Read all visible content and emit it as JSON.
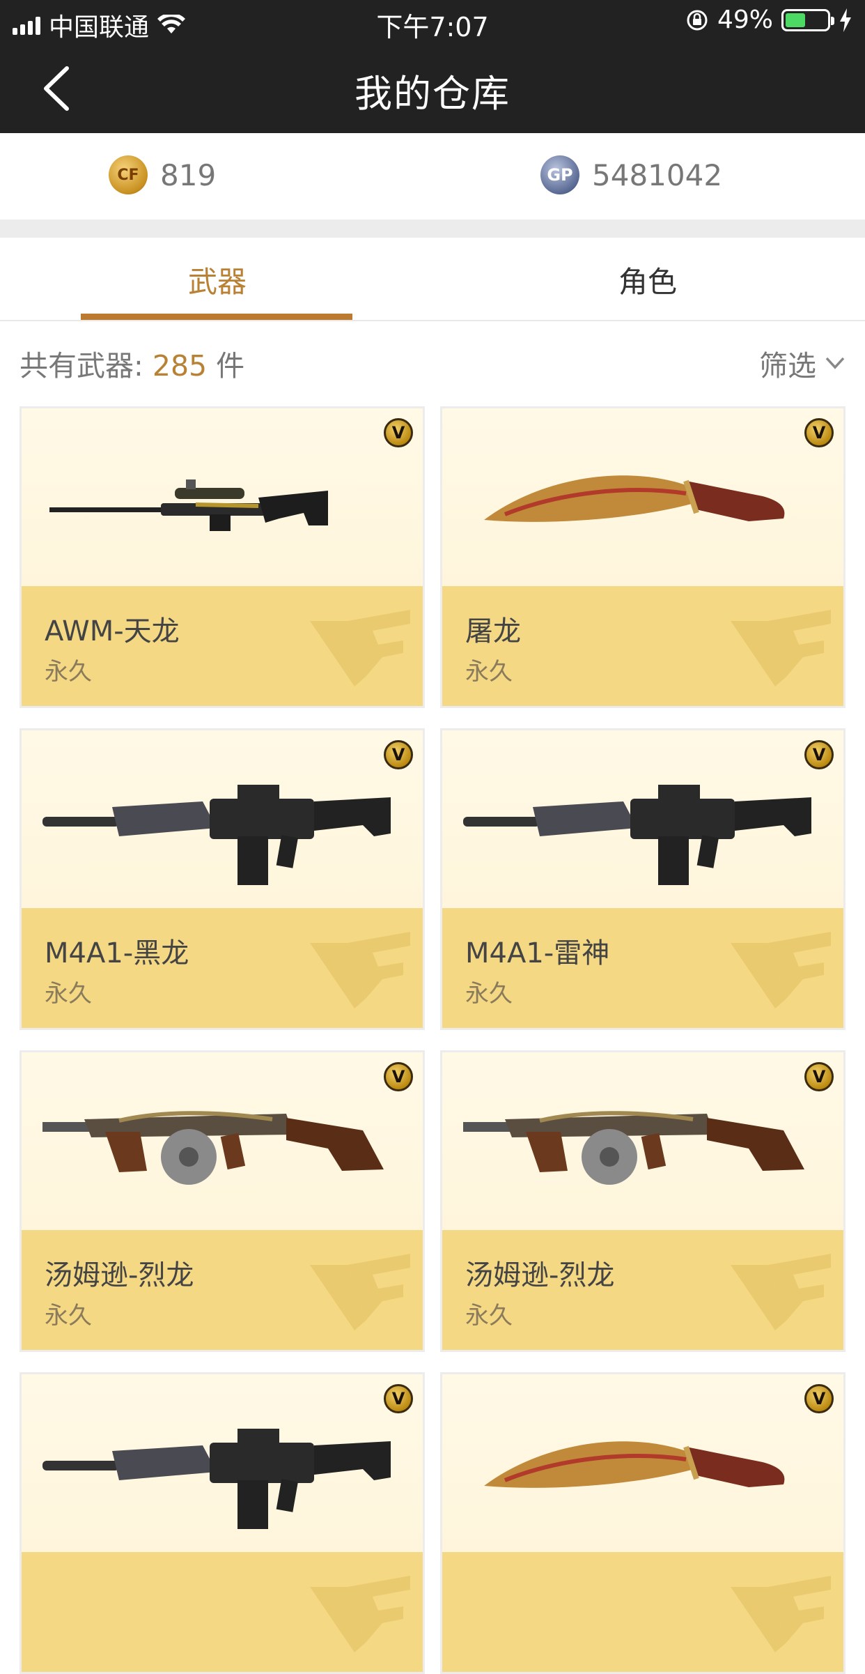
{
  "status": {
    "carrier": "中国联通",
    "time": "下午7:07",
    "battery": "49%",
    "battery_level": 0.49
  },
  "header": {
    "title": "我的仓库"
  },
  "currency": {
    "cf_points": "819",
    "gp": "5481042"
  },
  "tabs": [
    {
      "label": "武器",
      "active": true
    },
    {
      "label": "角色",
      "active": false
    }
  ],
  "summary": {
    "prefix": "共有武器: ",
    "count": "285",
    "suffix": " 件",
    "filter_label": "筛选"
  },
  "weapons": [
    {
      "name": "AWM-天龙",
      "duration": "永久",
      "icon": "sniper-rifle"
    },
    {
      "name": "屠龙",
      "duration": "永久",
      "icon": "kukri-knife"
    },
    {
      "name": "M4A1-黑龙",
      "duration": "永久",
      "icon": "assault-rifle"
    },
    {
      "name": "M4A1-雷神",
      "duration": "永久",
      "icon": "assault-rifle"
    },
    {
      "name": "汤姆逊-烈龙",
      "duration": "永久",
      "icon": "thompson-smg"
    },
    {
      "name": "汤姆逊-烈龙",
      "duration": "永久",
      "icon": "thompson-smg"
    },
    {
      "name": "",
      "duration": "",
      "icon": "assault-rifle"
    },
    {
      "name": "",
      "duration": "",
      "icon": "kukri-knife"
    }
  ],
  "vip_badge": "V",
  "colors": {
    "accent": "#b98133",
    "card_top": "#fff8e0",
    "card_bottom": "#f4d884",
    "header_bg": "#222222"
  }
}
